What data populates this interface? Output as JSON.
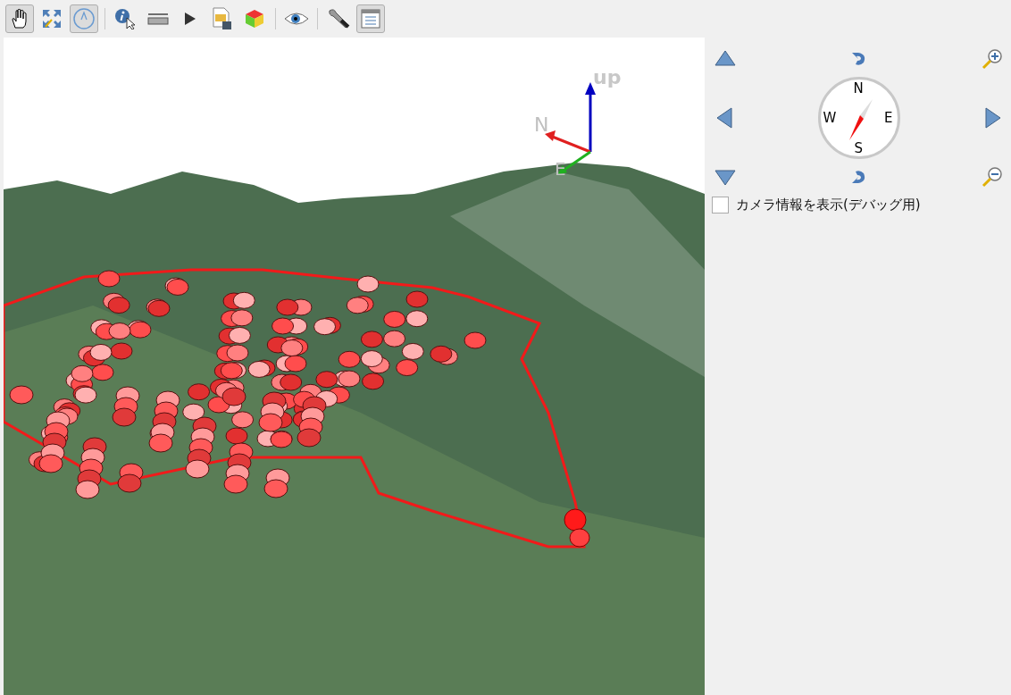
{
  "toolbar": {
    "groups": [
      [
        {
          "kind": "pan",
          "selected": true
        },
        {
          "kind": "zoom-full",
          "selected": false
        },
        {
          "kind": "camera-control",
          "selected": true
        }
      ],
      [
        {
          "kind": "identify",
          "selected": false
        },
        {
          "kind": "measure",
          "selected": false
        },
        {
          "kind": "play",
          "selected": false
        },
        {
          "kind": "export",
          "selected": false
        },
        {
          "kind": "cube",
          "selected": false
        }
      ],
      [
        {
          "kind": "eye",
          "selected": false
        }
      ],
      [
        {
          "kind": "wrench",
          "selected": false
        },
        {
          "kind": "panel",
          "selected": true
        }
      ]
    ]
  },
  "viewport": {
    "axis_labels": [
      "up",
      "N",
      "E"
    ]
  },
  "navigation": {
    "compass": {
      "north": "N",
      "west": "W",
      "east": "E",
      "south": "S"
    },
    "debug_checkbox": {
      "label": "カメラ情報を表示(デバッグ用)",
      "checked": false
    }
  }
}
